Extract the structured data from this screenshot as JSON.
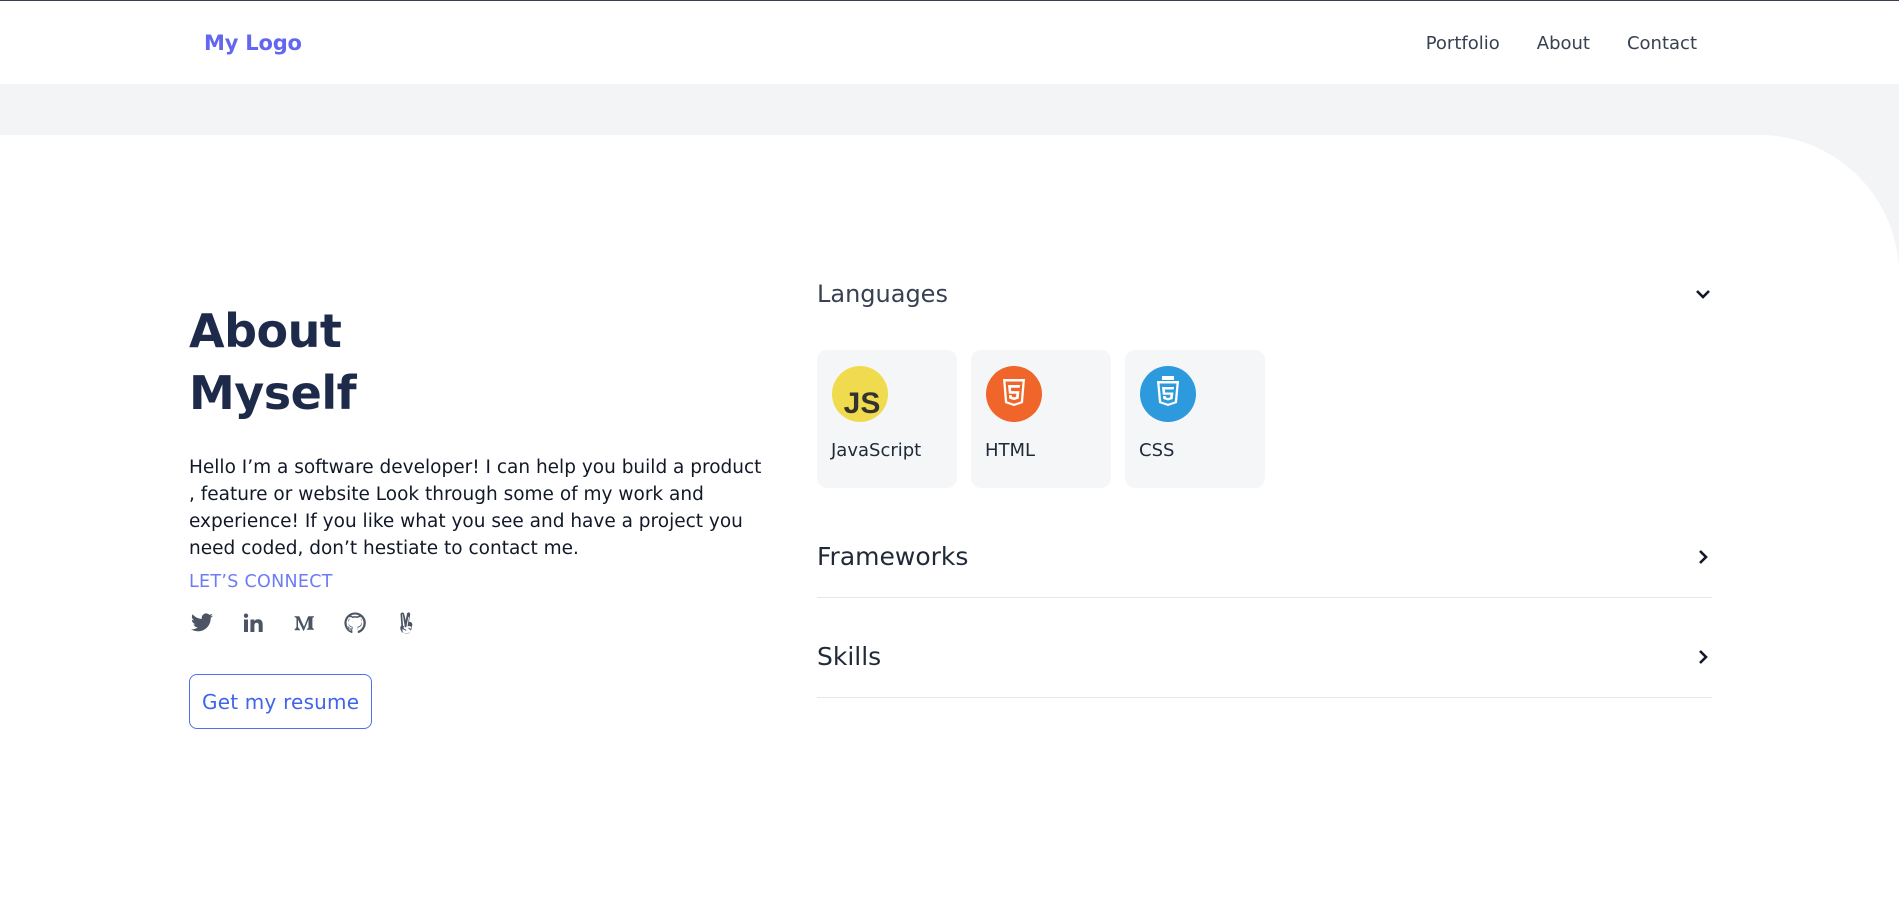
{
  "header": {
    "logo": "My Logo",
    "nav": [
      "Portfolio",
      "About",
      "Contact"
    ]
  },
  "about": {
    "title_line1": "About",
    "title_line2": "Myself",
    "bio": "Hello I’m a software developer! I can help you build a product , feature or website Look through some of my work and experience! If you like what you see and have a project you need coded, don’t hestiate to contact me.",
    "connect_label": "LET’S CONNECT",
    "socials": [
      "twitter-icon",
      "linkedin-icon",
      "medium-icon",
      "github-icon",
      "peace-hand-icon"
    ],
    "resume_button": "Get my resume"
  },
  "skills": {
    "sections": [
      {
        "label": "Languages",
        "expanded": true,
        "items": [
          {
            "name": "JavaScript",
            "icon": "javascript-icon",
            "color": "#f0db4f"
          },
          {
            "name": "HTML",
            "icon": "html5-icon",
            "color": "#f06529"
          },
          {
            "name": "CSS",
            "icon": "css3-icon",
            "color": "#2d9ade"
          }
        ]
      },
      {
        "label": "Frameworks",
        "expanded": false
      },
      {
        "label": "Skills",
        "expanded": false
      }
    ]
  },
  "colors": {
    "accent": "#6366f1",
    "heading": "#1e2a4a",
    "button_border": "#4f6ff0"
  }
}
